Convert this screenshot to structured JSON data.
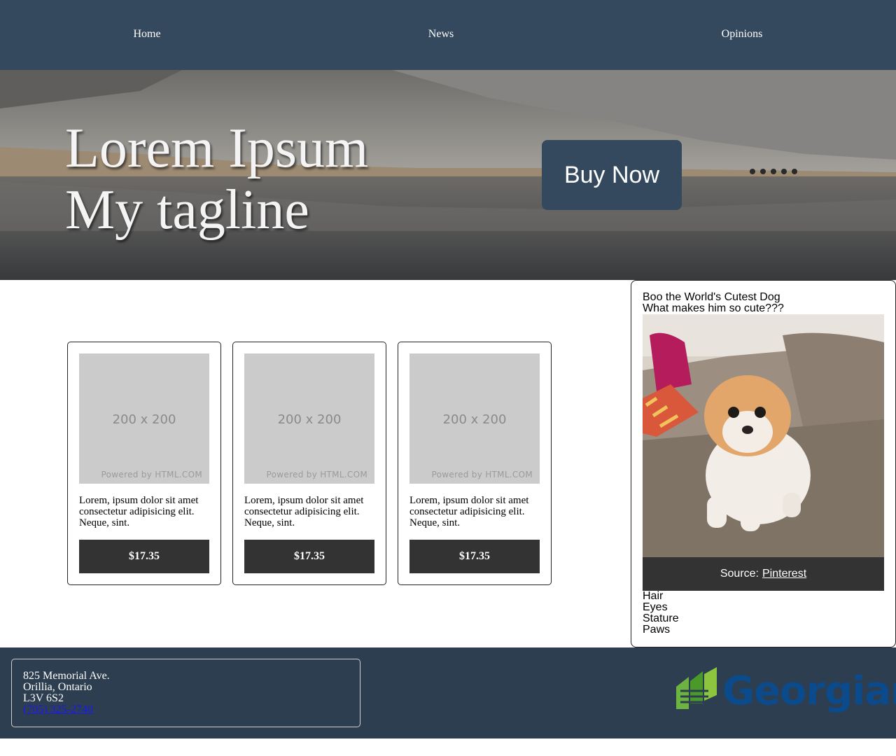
{
  "nav": {
    "items": [
      {
        "label": "Home"
      },
      {
        "label": "News"
      },
      {
        "label": "Opinions"
      }
    ]
  },
  "hero": {
    "title": "Lorem Ipsum",
    "tagline": "My tagline",
    "cta_label": "Buy Now"
  },
  "cards": [
    {
      "image_label": "200 x 200",
      "image_credit": "Powered by HTML.COM",
      "text": "Lorem, ipsum dolor sit amet consectetur adipisicing elit. Neque, sint.",
      "price": "$17.35"
    },
    {
      "image_label": "200 x 200",
      "image_credit": "Powered by HTML.COM",
      "text": "Lorem, ipsum dolor sit amet consectetur adipisicing elit. Neque, sint.",
      "price": "$17.35"
    },
    {
      "image_label": "200 x 200",
      "image_credit": "Powered by HTML.COM",
      "text": "Lorem, ipsum dolor sit amet consectetur adipisicing elit. Neque, sint.",
      "price": "$17.35"
    }
  ],
  "aside": {
    "title": "Boo the World's Cutest Dog",
    "subtitle": "What makes him so cute???",
    "caption_prefix": "Source:",
    "caption_link": "Pinterest",
    "traits": [
      "Hair",
      "Eyes",
      "Stature",
      "Paws"
    ]
  },
  "footer": {
    "address_lines": [
      "825 Memorial Ave.",
      "Orillia, Ontario",
      "L3V 6S2"
    ],
    "phone": "(705) 325-2740",
    "logo_text": "Georgian"
  },
  "colors": {
    "nav_bg": "#34495e",
    "footer_bg": "#2c3e50",
    "button_dark": "#333333",
    "link": "#1a1aee",
    "logo_blue": "#0b4a8b",
    "logo_green": "#6cb33f"
  }
}
